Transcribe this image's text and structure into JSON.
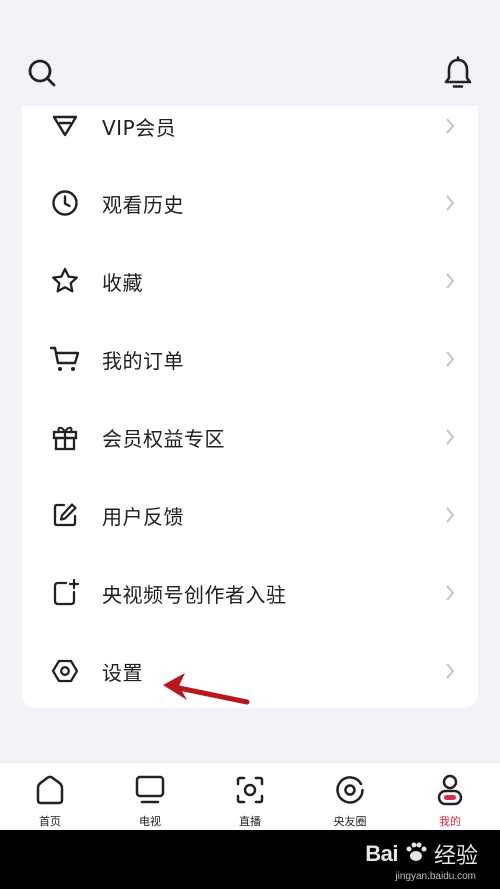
{
  "header": {
    "search_icon": "search-icon",
    "bell_icon": "bell-icon"
  },
  "menu": {
    "items": [
      {
        "label": "VIP会员",
        "icon": "diamond-icon"
      },
      {
        "label": "观看历史",
        "icon": "clock-icon"
      },
      {
        "label": "收藏",
        "icon": "star-icon"
      },
      {
        "label": "我的订单",
        "icon": "cart-icon"
      },
      {
        "label": "会员权益专区",
        "icon": "gift-icon"
      },
      {
        "label": "用户反馈",
        "icon": "edit-icon"
      },
      {
        "label": "央视频号创作者入驻",
        "icon": "creator-icon"
      },
      {
        "label": "设置",
        "icon": "settings-icon"
      }
    ]
  },
  "tabbar": {
    "items": [
      {
        "label": "首页",
        "icon": "home-icon"
      },
      {
        "label": "电视",
        "icon": "tv-icon"
      },
      {
        "label": "直播",
        "icon": "live-icon"
      },
      {
        "label": "央友圈",
        "icon": "circle-icon"
      },
      {
        "label": "我的",
        "icon": "profile-icon"
      }
    ],
    "active_color": "#e0294a"
  },
  "watermark": {
    "brand": "Bai",
    "brand_suffix": "经验",
    "url": "jingyan.baidu.com"
  }
}
